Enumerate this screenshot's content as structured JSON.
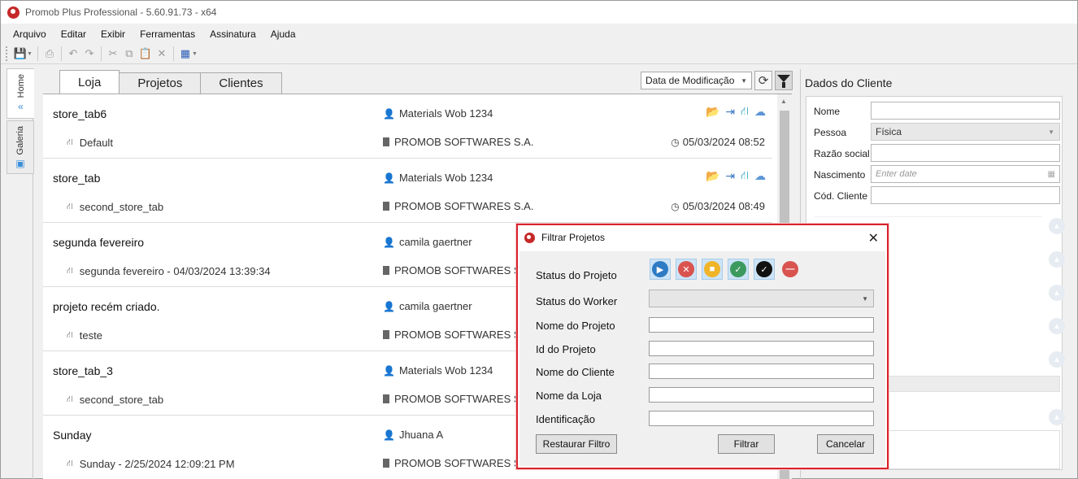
{
  "window": {
    "title": "Promob Plus Professional - 5.60.91.73 - x64"
  },
  "menu": [
    "Arquivo",
    "Editar",
    "Exibir",
    "Ferramentas",
    "Assinatura",
    "Ajuda"
  ],
  "side_tabs": {
    "home": "Home",
    "gallery": "Galeria"
  },
  "tabs": [
    "Loja",
    "Projetos",
    "Clientes"
  ],
  "sort": {
    "selected": "Data de Modificação"
  },
  "projects": [
    {
      "name": "store_tab6",
      "store": "Default",
      "user": "Materials Wob 1234",
      "company": "PROMOB SOFTWARES S.A.",
      "date": "05/03/2024 08:52",
      "actions": true
    },
    {
      "name": "store_tab",
      "store": "second_store_tab",
      "user": "Materials Wob 1234",
      "company": "PROMOB SOFTWARES S.A.",
      "date": "05/03/2024 08:49",
      "actions": true
    },
    {
      "name": "segunda fevereiro",
      "store": "segunda fevereiro - 04/03/2024 13:39:34",
      "user": "camila gaertner",
      "company": "PROMOB SOFTWARES S.A.",
      "date": "",
      "actions": false
    },
    {
      "name": "projeto recém criado.",
      "store": "teste",
      "user": "camila gaertner",
      "company": "PROMOB SOFTWARES S.A.",
      "date": "",
      "actions": false
    },
    {
      "name": "store_tab_3",
      "store": "second_store_tab",
      "user": "Materials Wob 1234",
      "company": "PROMOB SOFTWARES S.A.",
      "date": "",
      "actions": false
    },
    {
      "name": "Sunday",
      "store": "Sunday - 2/25/2024 12:09:21 PM",
      "user": "Jhuana A",
      "company": "PROMOB SOFTWARES S.A.",
      "date": "",
      "actions": false
    }
  ],
  "client_panel": {
    "title": "Dados do Cliente",
    "name_label": "Nome",
    "person_label": "Pessoa",
    "person_value": "Física",
    "company_label": "Razão social",
    "birth_label": "Nascimento",
    "birth_placeholder": "Enter date",
    "code_label": "Cód. Cliente"
  },
  "dialog": {
    "title": "Filtrar Projetos",
    "status_project_label": "Status do Projeto",
    "status_worker_label": "Status do Worker",
    "project_name_label": "Nome do Projeto",
    "project_id_label": "Id do Projeto",
    "client_name_label": "Nome do Cliente",
    "store_name_label": "Nome da Loja",
    "identification_label": "Identificação",
    "reset_button": "Restaurar Filtro",
    "filter_button": "Filtrar",
    "cancel_button": "Cancelar",
    "status_icons": [
      {
        "name": "play-status-icon",
        "color": "#2e7bc4",
        "glyph": "▶"
      },
      {
        "name": "cancel-status-icon",
        "color": "#d9534f",
        "glyph": "✕"
      },
      {
        "name": "stop-status-icon",
        "color": "#f0b429",
        "glyph": "■"
      },
      {
        "name": "check-status-icon",
        "color": "#3c9a5f",
        "glyph": "✓"
      },
      {
        "name": "double-check-status-icon",
        "color": "#111111",
        "glyph": "✓"
      },
      {
        "name": "blocked-status-icon",
        "color": "#d9534f",
        "glyph": "—"
      }
    ]
  }
}
